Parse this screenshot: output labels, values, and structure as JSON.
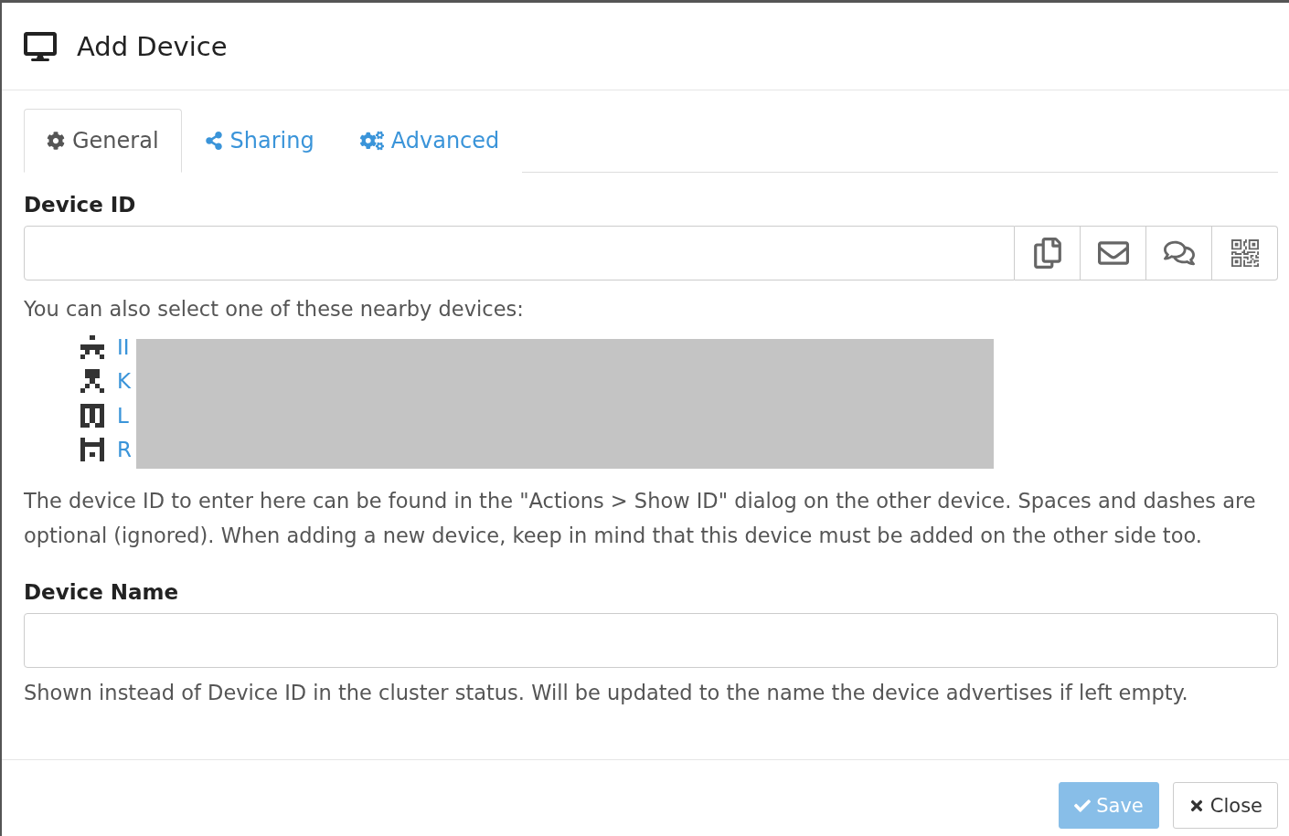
{
  "dialog": {
    "title": "Add Device"
  },
  "tabs": [
    {
      "label": "General",
      "kind": "gear",
      "selected": true
    },
    {
      "label": "Sharing",
      "kind": "share",
      "selected": false
    },
    {
      "label": "Advanced",
      "kind": "gears",
      "selected": false
    }
  ],
  "device_id": {
    "label": "Device ID",
    "nearby_hint": "You can also select one of these nearby devices:",
    "nearby_devices": [
      {
        "name": "II",
        "kind": "a"
      },
      {
        "name": "K",
        "kind": "b"
      },
      {
        "name": "L",
        "kind": "c"
      },
      {
        "name": "R",
        "kind": "d"
      }
    ],
    "help": "The device ID to enter here can be found in the \"Actions > Show ID\" dialog on the other device. Spaces and dashes are optional (ignored). When adding a new device, keep in mind that this device must be added on the other side too."
  },
  "device_name": {
    "label": "Device Name",
    "help": "Shown instead of Device ID in the cluster status. Will be updated to the name the device advertises if left empty."
  },
  "buttons": [
    {
      "label": "Save",
      "kind": "primary",
      "disabled": true
    },
    {
      "label": "Close",
      "kind": "default",
      "disabled": false
    }
  ]
}
